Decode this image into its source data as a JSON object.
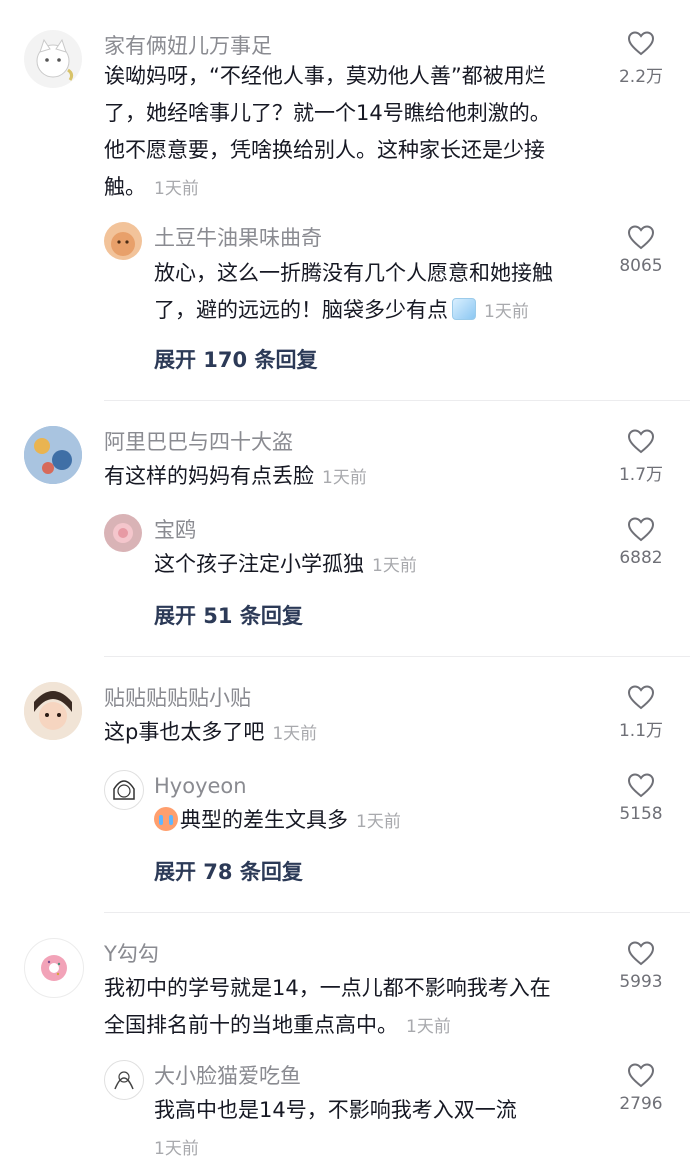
{
  "comments": [
    {
      "user": "家有俩妞儿万事足",
      "lines": [
        "诶呦妈呀，“不经他人事，莫劝他人善”都被用烂",
        "了，她经啥事儿了？就一个14号瞧给他刺激的。",
        "他不愿意要，凭啥换给别人。这种家长还是少接",
        "触。"
      ],
      "time": "1天前",
      "likes": "2.2万",
      "reply": {
        "user": "土豆牛油果味曲奇",
        "lines": [
          "放心，这么一折腾没有几个人愿意和她接触",
          "了，避的远远的！脑袋多少有点"
        ],
        "emoji": "ice-cube-emoji",
        "time": "1天前",
        "likes": "8065"
      },
      "expand": "展开 170 条回复"
    },
    {
      "user": "阿里巴巴与四十大盗",
      "lines": [
        "有这样的妈妈有点丢脸"
      ],
      "time": "1天前",
      "likes": "1.7万",
      "reply": {
        "user": "宝鸥",
        "lines": [
          "这个孩子注定小学孤独"
        ],
        "time": "1天前",
        "likes": "6882"
      },
      "expand": "展开 51 条回复"
    },
    {
      "user": "贴贴贴贴贴小贴",
      "lines": [
        "这p事也太多了吧"
      ],
      "time": "1天前",
      "likes": "1.1万",
      "reply": {
        "user": "Hyoyeon",
        "lines": [
          "典型的差生文具多"
        ],
        "emoji": "crying-face-emoji",
        "time": "1天前",
        "likes": "5158"
      },
      "expand": "展开 78 条回复"
    },
    {
      "user": "Y勾勾",
      "lines": [
        "我初中的学号就是14，一点儿都不影响我考入在",
        "全国排名前十的当地重点高中。"
      ],
      "time": "1天前",
      "likes": "5993",
      "reply": {
        "user": "大小脸猫爱吃鱼",
        "lines": [
          "我高中也是14号，不影响我考入双一流"
        ],
        "time": "1天前",
        "likes": "2796"
      }
    }
  ],
  "colors": {
    "username": "#8a8b91",
    "text": "#161823",
    "time": "#a8a9ad",
    "expand": "#2c3a57"
  }
}
